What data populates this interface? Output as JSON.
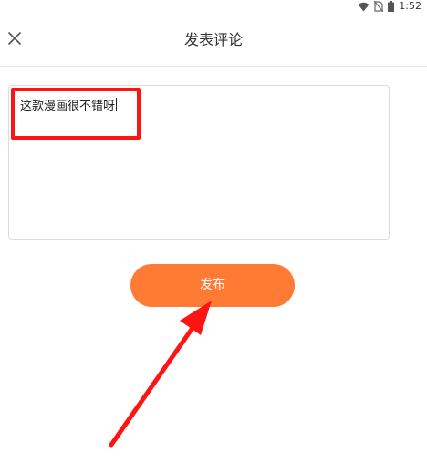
{
  "status_bar": {
    "time": "1:52",
    "icons": [
      "wifi-icon",
      "no-sim-icon",
      "battery-icon"
    ]
  },
  "header": {
    "title": "发表评论",
    "close_icon": "close-icon"
  },
  "comment": {
    "value": "这款漫画很不错呀"
  },
  "actions": {
    "publish_label": "发布"
  },
  "colors": {
    "accent": "#ff7a33",
    "annotation": "#ff1414"
  }
}
